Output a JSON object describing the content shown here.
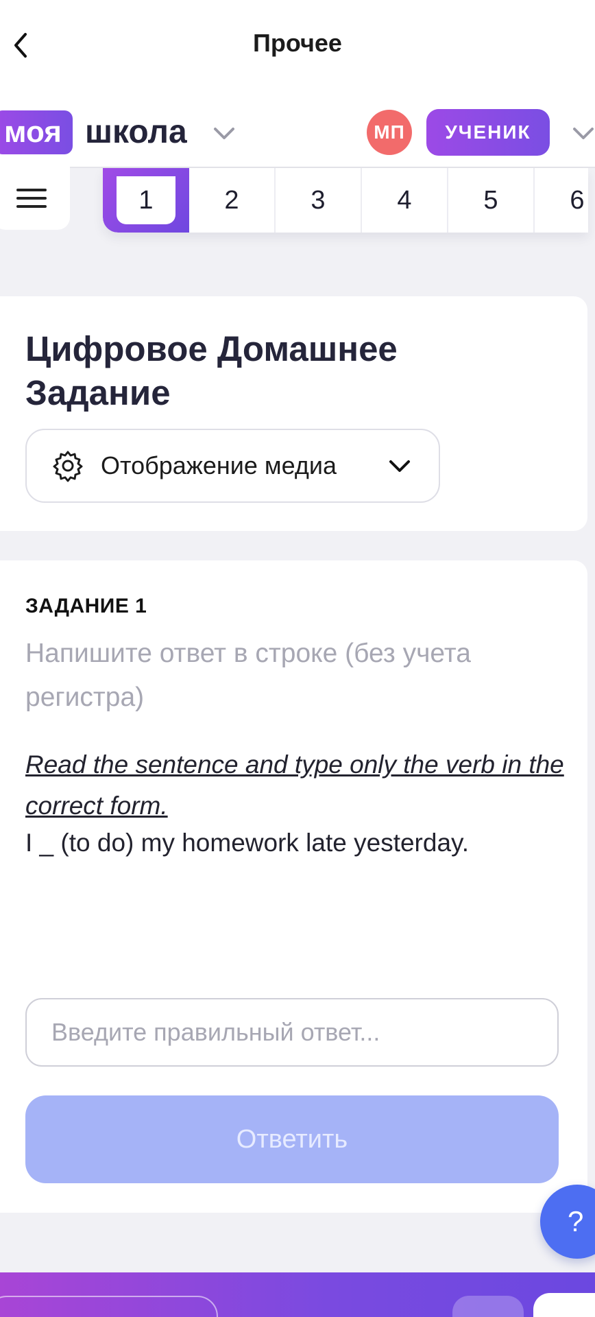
{
  "topbar": {
    "title": "Прочее",
    "back_icon": "chevron-left-icon"
  },
  "header": {
    "logo_part1": "моя",
    "logo_part2": "школа",
    "avatar_initials": "МП",
    "role": "УЧЕНИК",
    "accent_color": "#8a4ae4",
    "avatar_color": "#f26b6b"
  },
  "question_nav": {
    "menu_icon": "hamburger-menu-icon",
    "items": [
      "1",
      "2",
      "3",
      "4",
      "5",
      "6"
    ],
    "active": "1"
  },
  "homework": {
    "title": "Цифровое Домашнее Задание",
    "media_toggle": {
      "icon": "gear-icon",
      "label": "Отображение медиа"
    }
  },
  "task": {
    "label": "ЗАДАНИЕ 1",
    "hint": "Напишите ответ в строке (без учета регистра)",
    "instruction": "Read the sentence and type only the verb in the correct form.",
    "sentence": "I _ (to do) my homework late yesterday.",
    "input_placeholder": "Введите правильный ответ...",
    "input_value": "",
    "submit_label": "Ответить",
    "submit_color": "#a5b3f7"
  },
  "help_button": {
    "label": "?"
  }
}
